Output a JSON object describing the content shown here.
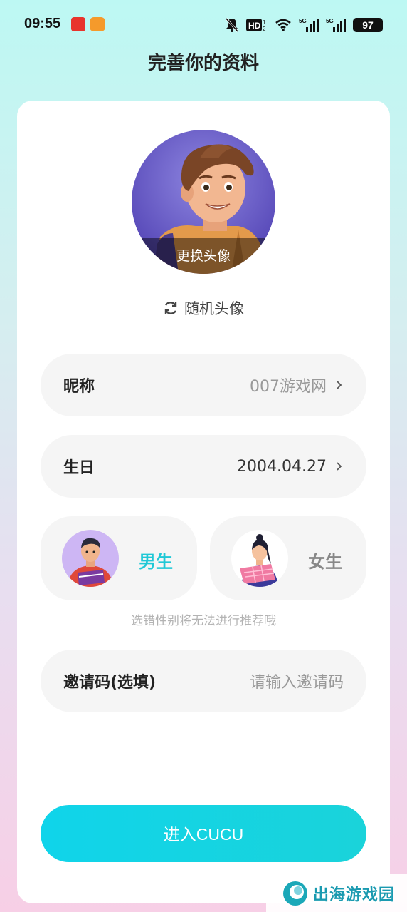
{
  "status_bar": {
    "time": "09:55",
    "battery": "97",
    "icons": [
      "notification-app-icon",
      "food-app-icon",
      "mute-bell-icon",
      "hd-icon",
      "wifi-icon",
      "signal-5g-icon",
      "signal-5g-icon",
      "battery-icon"
    ]
  },
  "header": {
    "title": "完善你的资料"
  },
  "avatar": {
    "change_label": "更换头像"
  },
  "random_avatar": {
    "label": "随机头像",
    "icon": "refresh-icon"
  },
  "nickname": {
    "label": "昵称",
    "value": "007游戏网"
  },
  "birthday": {
    "label": "生日",
    "value": "2004.04.27"
  },
  "gender": {
    "male_label": "男生",
    "female_label": "女生",
    "selected": "male",
    "hint": "选错性别将无法进行推荐哦"
  },
  "invite": {
    "label": "邀请码(选填)",
    "placeholder": "请输入邀请码"
  },
  "submit": {
    "label": "进入CUCU"
  },
  "watermark": {
    "text": "出海游戏园"
  },
  "colors": {
    "accent": "#1ad3e0",
    "male_selected_text": "#1fc8d6",
    "unselected_text": "#888888",
    "card_bg": "#ffffff",
    "field_bg": "#f5f5f5"
  }
}
